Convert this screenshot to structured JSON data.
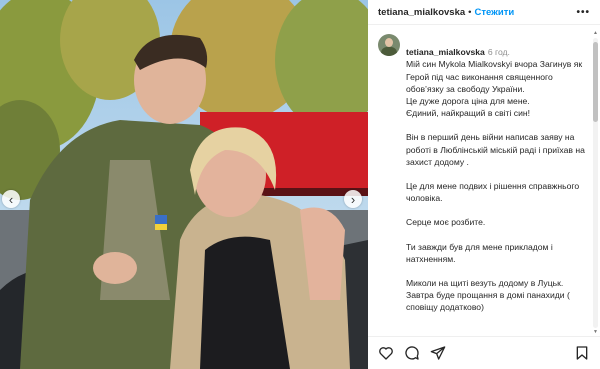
{
  "post": {
    "username": "tetiana_mialkovska",
    "follow_label": "Стежити",
    "more_label": "•••",
    "time": "6 год.",
    "caption": [
      "Мій син Mykola Mialkovskyi вчора Загинув як Герой під час виконання священного обов’язку за свободу України.\nЦе дуже дорога ціна для мене.\nЄдиний, найкращий в світі син!",
      "Він в перший день війни написав заяву на роботі в Люблінській міській раді і приїхав на захист додому .",
      "Це для мене подвих і рішення справжнього чоловіка.",
      "Серце моє розбите.",
      "Ти завжди був для мене прикладом і натхненням.",
      "Миколи на щиті везуть додому в Луцьк.\nЗавтра буде прощання в домі панахиди ( сповіщу додатково)"
    ]
  },
  "icons": {
    "like": "heart-icon",
    "comment": "comment-icon",
    "share": "paper-plane-icon",
    "save": "bookmark-icon",
    "prev": "chevron-left-icon",
    "next": "chevron-right-icon"
  },
  "colors": {
    "follow": "#0095f6",
    "text": "#262626",
    "muted": "#8e8e8e"
  }
}
